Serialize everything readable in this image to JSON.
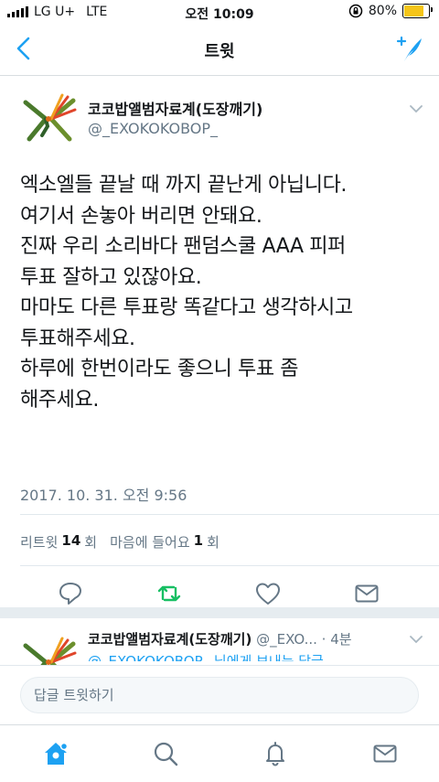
{
  "status": {
    "carrier": "LG U+",
    "network": "LTE",
    "time": "오전 10:09",
    "battery": "80%"
  },
  "nav": {
    "title": "트윗"
  },
  "tweet": {
    "author_name": "코코밥앨범자료계(도장깨기)",
    "author_handle": "@_EXOKOKOBOP_",
    "lines": [
      "엑소엘들 끝날 때 까지 끝난게 아닙니다.",
      "여기서 손놓아 버리면 안돼요.",
      "진짜 우리 소리바다 팬덤스쿨 AAA 피퍼",
      "투표 잘하고 있잖아요.",
      "마마도 다른 투표랑 똑같다고 생각하시고",
      "투표해주세요.",
      "하루에 한번이라도 좋으니 투표 좀",
      "해주세요."
    ],
    "timestamp": "2017. 10. 31. 오전 9:56",
    "retweet_label": "리트윗",
    "retweet_count": "14",
    "count_unit": "회",
    "like_label": "마음에 들어요",
    "like_count": "1",
    "like_unit": "회"
  },
  "reply": {
    "author_name": "코코밥앨범자료계(도장깨기)",
    "author_handle_trunc": "@_EXO...",
    "time_ago": "· 4분",
    "subline": "@_EXOKOKOBOP_ 님에게 보내는 답글"
  },
  "composer": {
    "placeholder": "답글 트윗하기"
  },
  "colors": {
    "accent": "#1da1f2",
    "retweet_green": "#17bf63"
  }
}
